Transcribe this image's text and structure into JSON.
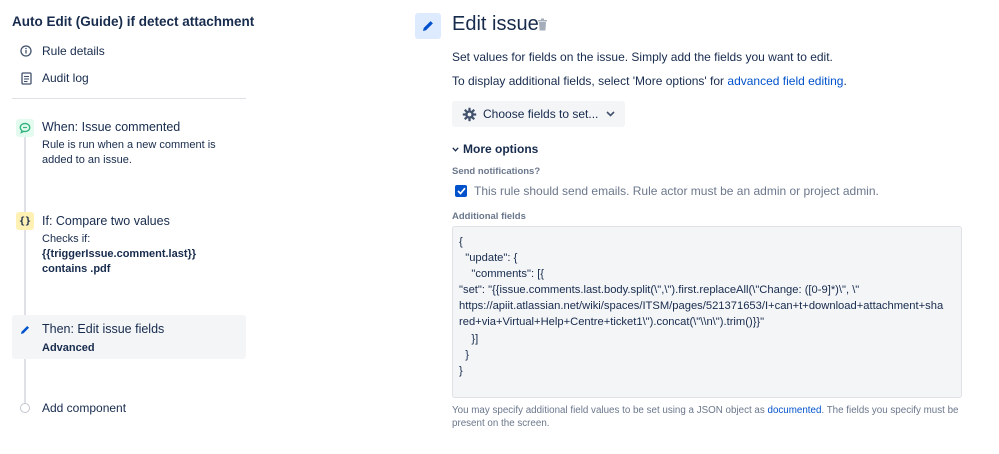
{
  "sidebar": {
    "rule_title": "Auto Edit (Guide) if detect attachment",
    "nav": [
      {
        "label": "Rule details",
        "icon": "info-icon"
      },
      {
        "label": "Audit log",
        "icon": "document-icon"
      }
    ],
    "components": [
      {
        "kind": "trigger",
        "title": "When: Issue commented",
        "desc_lines": [
          "Rule is run when a new comment is",
          "added to an issue."
        ],
        "icon": "comment-icon",
        "color": "#36b37e"
      },
      {
        "kind": "condition",
        "title": "If: Compare two values",
        "desc_lines": [
          "Checks if:"
        ],
        "bold_lines": [
          "{{triggerIssue.comment.last}}",
          "contains .pdf"
        ],
        "icon": "braces-icon",
        "color": "#ffab00"
      },
      {
        "kind": "action",
        "title": "Then: Edit issue fields",
        "bold_lines": [
          "Advanced"
        ],
        "icon": "pencil-icon",
        "color": "#0052cc"
      }
    ],
    "add_component_label": "Add component"
  },
  "main": {
    "title": "Edit issue",
    "description": "Set values for fields on the issue. Simply add the fields you want to edit.",
    "display_prefix": "To display additional fields, select 'More options' for ",
    "display_link": "advanced field editing",
    "display_suffix": ".",
    "choose_fields_label": "Choose fields to set...",
    "more_options_label": "More options",
    "send_notifications_label": "Send notifications?",
    "send_emails_checked": true,
    "send_emails_text": "This rule should send emails. Rule actor must be an admin or project admin.",
    "additional_fields_label": "Additional fields",
    "json_lines": [
      "{",
      "  \"update\": {",
      "    \"comments\": [{",
      "\"set\": \"{{issue.comments.last.body.split(\\\",\\\").first.replaceAll(\\\"Change: ([0-9]*)\\\", \\\"",
      "https://apiit.atlassian.net/wiki/spaces/ITSM/pages/521371653/I+can+t+download+attachment+sha",
      "red+via+Virtual+Help+Centre+ticket1\\\").concat(\\\"\\\\n\\\").trim()}}\"",
      "    }]",
      "  }",
      "}"
    ],
    "help_prefix": "You may specify additional field values to be set using a JSON object as ",
    "help_link": "documented",
    "help_suffix": ". The fields you specify must be present on the screen."
  },
  "colors": {
    "accent": "#0052cc",
    "trigger": "#36b37e",
    "condition": "#ffab00"
  }
}
